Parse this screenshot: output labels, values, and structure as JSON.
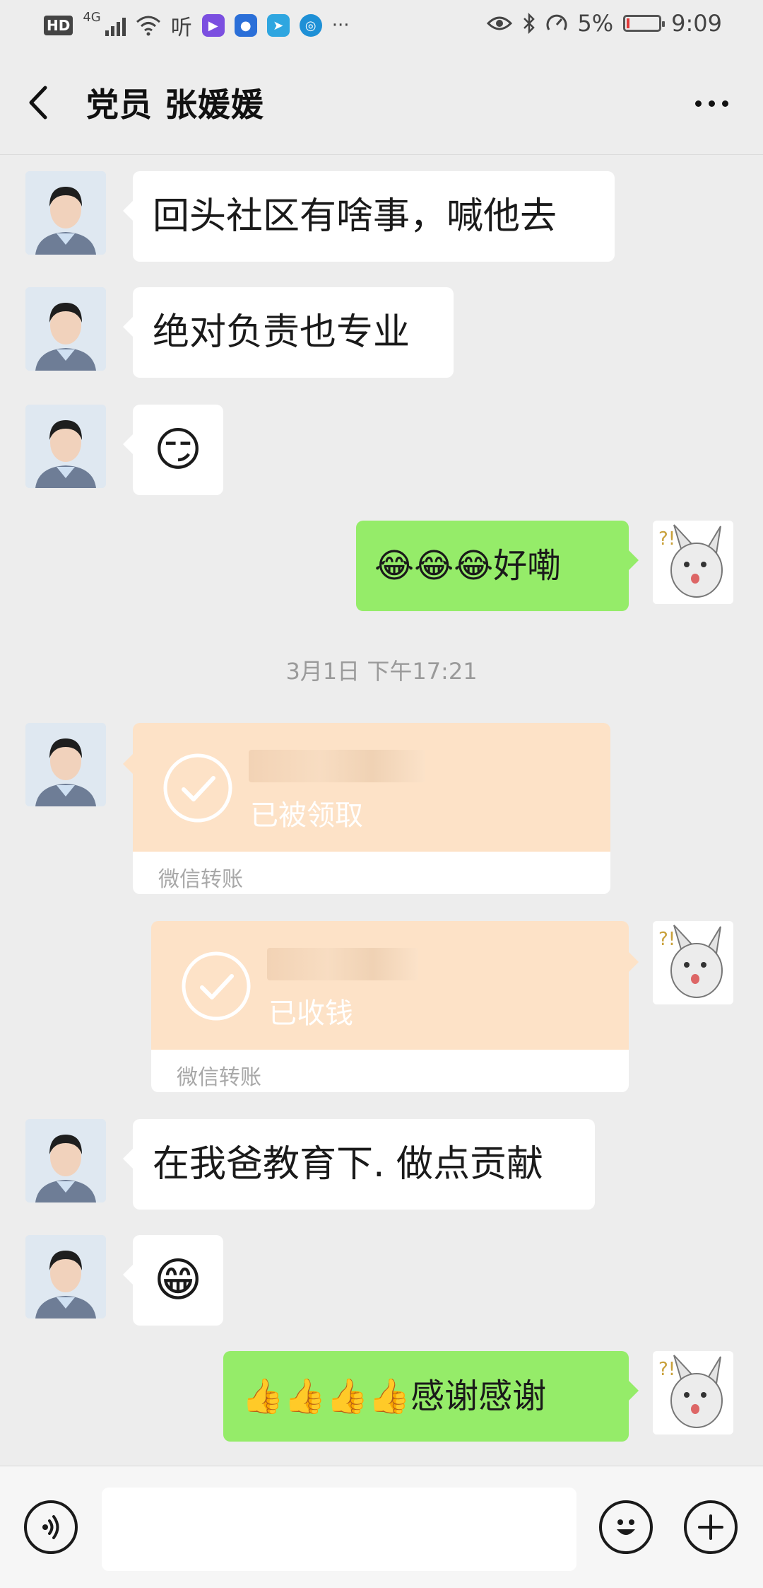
{
  "status_bar": {
    "hd": "HD",
    "network": "4G",
    "listen": "听",
    "more": "···",
    "battery": "5%",
    "battery_level": 0.05,
    "time": "9:09",
    "icons": [
      "eye-icon",
      "bluetooth-icon",
      "speed-icon"
    ]
  },
  "header": {
    "title": "党员 张媛媛"
  },
  "messages": {
    "m1": "回头社区有啥事，喊他去",
    "m2": "绝对负责也专业",
    "m3": "😏",
    "m4": "😂😂😂好嘞",
    "time": "3月1日 下午17:21",
    "m7": "在我爸教育下. 做点贡献",
    "m8": "😁",
    "m9": "👍👍👍👍感谢感谢"
  },
  "transfers": {
    "incoming": {
      "status": "已被领取",
      "label": "微信转账"
    },
    "outgoing": {
      "status": "已收钱",
      "label": "微信转账"
    }
  },
  "input": {
    "placeholder": ""
  },
  "colors": {
    "background": "#ededed",
    "outgoing_bubble": "#95ec69",
    "incoming_bubble": "#ffffff",
    "transfer_card": "#fde2c7",
    "battery_low": "#e03a3a"
  }
}
